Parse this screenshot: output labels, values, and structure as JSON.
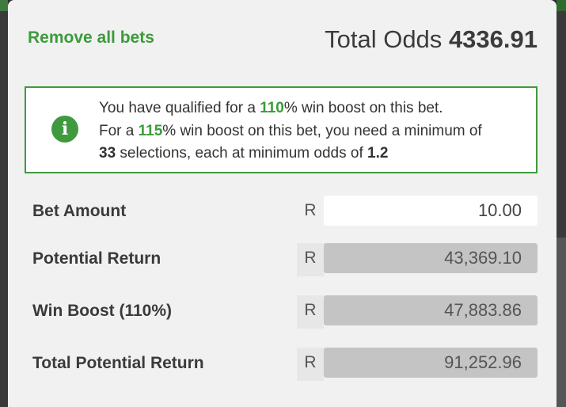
{
  "header": {
    "remove_all_label": "Remove all bets",
    "total_odds_label": "Total Odds",
    "total_odds_value": "4336.91"
  },
  "info": {
    "icon": "info-icon",
    "line1_pre": "You have qualified for a ",
    "line1_pct": "110",
    "line1_post": "% win boost on this bet.",
    "line2_pre": "For a ",
    "line2_pct": "115",
    "line2_post": "% win boost on this bet, you need a minimum of",
    "line3_count": "33",
    "line3_mid": " selections, each at minimum odds of ",
    "line3_odds": "1.2"
  },
  "rows": [
    {
      "label": "Bet Amount",
      "currency": "R",
      "value": "10.00"
    },
    {
      "label": "Potential Return",
      "currency": "R",
      "value": "43,369.10"
    },
    {
      "label": "Win Boost (110%)",
      "currency": "R",
      "value": "47,883.86"
    },
    {
      "label": "Total Potential Return",
      "currency": "R",
      "value": "91,252.96"
    }
  ],
  "colors": {
    "accent_green": "#3c9b3c",
    "panel_bg": "#f1f1f1",
    "readonly_field": "#c4c4c4"
  }
}
